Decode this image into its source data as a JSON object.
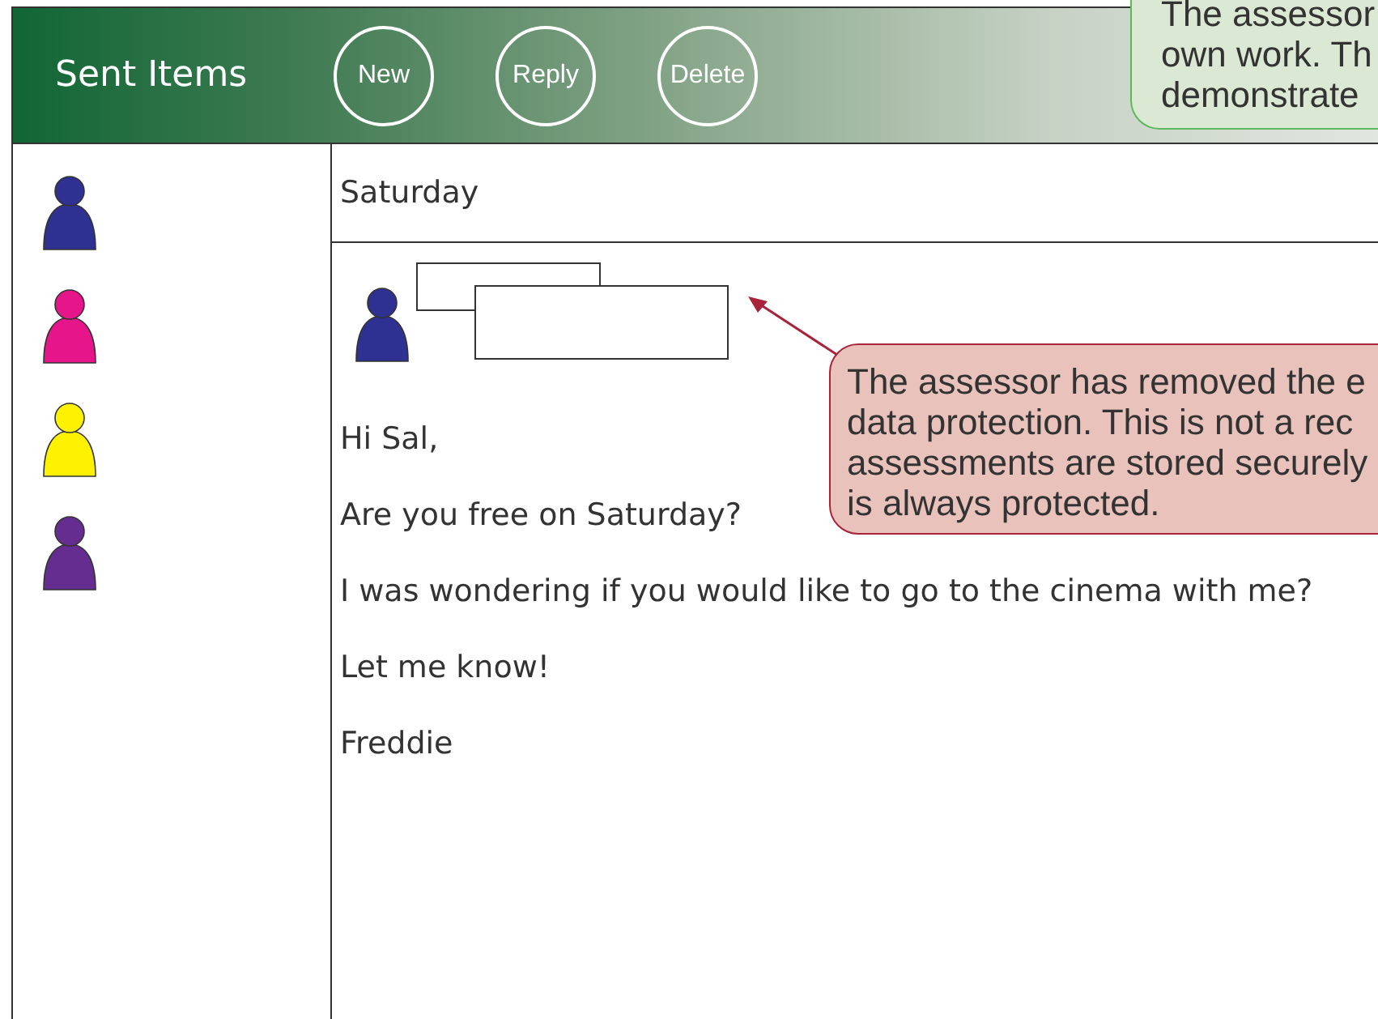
{
  "header": {
    "title": "Sent Items",
    "buttons": [
      "New",
      "Reply",
      "Delete"
    ]
  },
  "sidebar": {
    "items": [
      {
        "color": "#2e3192"
      },
      {
        "color": "#e6168a"
      },
      {
        "color": "#fff200"
      },
      {
        "color": "#662d91"
      }
    ]
  },
  "message": {
    "subject": "Saturday",
    "sender_avatar": {
      "color": "#2e3192"
    },
    "lines": [
      "Hi Sal,",
      "Are you free on Saturday?",
      "I was wondering if you would like to go to the cinema with me?",
      "Let me know!",
      "Freddie"
    ]
  },
  "notes": [
    {
      "kind": "info",
      "lines": [
        "The assessor",
        "own work. Th",
        "demonstrate"
      ]
    },
    {
      "kind": "warning",
      "lines": [
        "The assessor has removed the e",
        "data protection. This is not a rec",
        "assessments are stored securely",
        "is always protected."
      ]
    }
  ]
}
